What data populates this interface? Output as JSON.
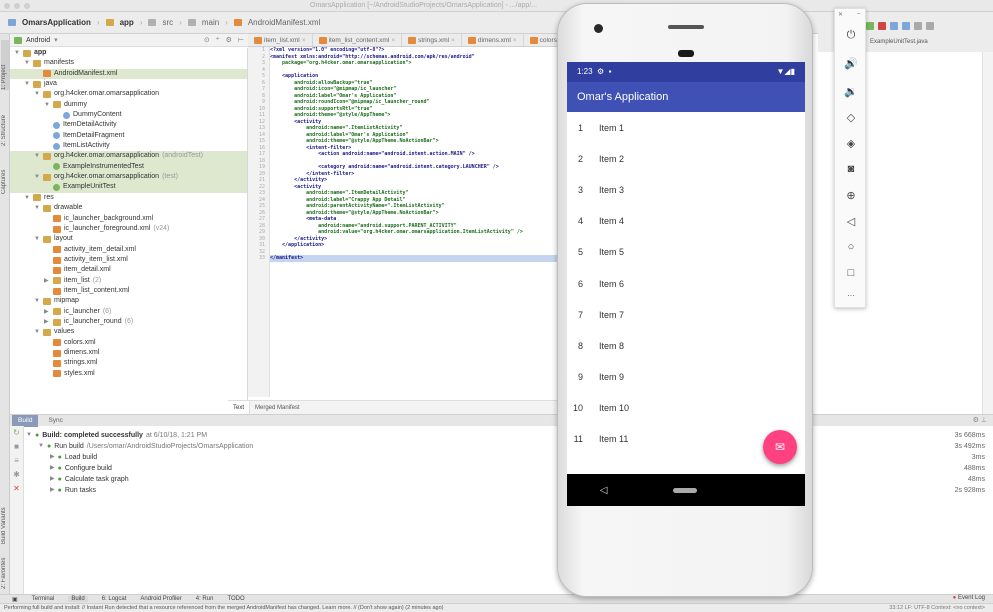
{
  "window": {
    "title": "OmarsApplication [~/AndroidStudioProjects/OmarsApplication] - .../app/..."
  },
  "navbar": {
    "crumbs": [
      "OmarsApplication",
      "app",
      "src",
      "main",
      "AndroidManifest.xml"
    ]
  },
  "project": {
    "view_label": "Android"
  },
  "side_tabs": [
    "1: Project",
    "2: Structure",
    "Captures",
    "Build Variants",
    "2: Favorites"
  ],
  "tree": [
    {
      "indent": 0,
      "arrow": "▼",
      "icon": "folder",
      "label": "app",
      "bold": true
    },
    {
      "indent": 1,
      "arrow": "▼",
      "icon": "folder",
      "label": "manifests"
    },
    {
      "indent": 2,
      "arrow": "",
      "icon": "manifest",
      "label": "AndroidManifest.xml",
      "highlight": true
    },
    {
      "indent": 1,
      "arrow": "▼",
      "icon": "folder",
      "label": "java"
    },
    {
      "indent": 2,
      "arrow": "▼",
      "icon": "folder",
      "label": "org.h4cker.omar.omarsapplication"
    },
    {
      "indent": 3,
      "arrow": "▼",
      "icon": "folder",
      "label": "dummy"
    },
    {
      "indent": 4,
      "arrow": "",
      "icon": "class",
      "label": "DummyContent"
    },
    {
      "indent": 3,
      "arrow": "",
      "icon": "class",
      "label": "ItemDetailActivity"
    },
    {
      "indent": 3,
      "arrow": "",
      "icon": "class",
      "label": "ItemDetailFragment"
    },
    {
      "indent": 3,
      "arrow": "",
      "icon": "class",
      "label": "ItemListActivity"
    },
    {
      "indent": 2,
      "arrow": "▼",
      "icon": "folder",
      "label": "org.h4cker.omar.omarsapplication",
      "suffix": "(androidTest)",
      "highlight": true
    },
    {
      "indent": 3,
      "arrow": "",
      "icon": "test",
      "label": "ExampleInstrumentedTest",
      "highlight": true
    },
    {
      "indent": 2,
      "arrow": "▼",
      "icon": "folder",
      "label": "org.h4cker.omar.omarsapplication",
      "suffix": "(test)",
      "highlight": true
    },
    {
      "indent": 3,
      "arrow": "",
      "icon": "test",
      "label": "ExampleUnitTest",
      "highlight": true
    },
    {
      "indent": 1,
      "arrow": "▼",
      "icon": "folder",
      "label": "res"
    },
    {
      "indent": 2,
      "arrow": "▼",
      "icon": "folder",
      "label": "drawable"
    },
    {
      "indent": 3,
      "arrow": "",
      "icon": "xml",
      "label": "ic_launcher_background.xml"
    },
    {
      "indent": 3,
      "arrow": "",
      "icon": "xml",
      "label": "ic_launcher_foreground.xml",
      "suffix": "(v24)"
    },
    {
      "indent": 2,
      "arrow": "▼",
      "icon": "folder",
      "label": "layout"
    },
    {
      "indent": 3,
      "arrow": "",
      "icon": "xml",
      "label": "activity_item_detail.xml"
    },
    {
      "indent": 3,
      "arrow": "",
      "icon": "xml",
      "label": "activity_item_list.xml"
    },
    {
      "indent": 3,
      "arrow": "",
      "icon": "xml",
      "label": "item_detail.xml"
    },
    {
      "indent": 3,
      "arrow": "▶",
      "icon": "folder",
      "label": "item_list",
      "suffix": "(2)"
    },
    {
      "indent": 3,
      "arrow": "",
      "icon": "xml",
      "label": "item_list_content.xml"
    },
    {
      "indent": 2,
      "arrow": "▼",
      "icon": "folder",
      "label": "mipmap"
    },
    {
      "indent": 3,
      "arrow": "▶",
      "icon": "folder",
      "label": "ic_launcher",
      "suffix": "(6)"
    },
    {
      "indent": 3,
      "arrow": "▶",
      "icon": "folder",
      "label": "ic_launcher_round",
      "suffix": "(6)"
    },
    {
      "indent": 2,
      "arrow": "▼",
      "icon": "folder",
      "label": "values"
    },
    {
      "indent": 3,
      "arrow": "",
      "icon": "xml",
      "label": "colors.xml"
    },
    {
      "indent": 3,
      "arrow": "",
      "icon": "xml",
      "label": "dimens.xml"
    },
    {
      "indent": 3,
      "arrow": "",
      "icon": "xml",
      "label": "strings.xml"
    },
    {
      "indent": 3,
      "arrow": "",
      "icon": "xml",
      "label": "styles.xml"
    }
  ],
  "editor_tabs": [
    "item_list.xml",
    "item_list_content.xml",
    "strings.xml",
    "dimens.xml",
    "colors.xml"
  ],
  "code_lines": [
    {
      "t": "<?xml version=\"1.0\" encoding=\"utf-8\"?>",
      "att": false
    },
    {
      "t": "<manifest xmlns:android=\"http://schemas.android.com/apk/res/android\"",
      "att": false
    },
    {
      "t": "    package=\"org.h4cker.omar.omarsapplication\">",
      "att": true
    },
    {
      "t": "",
      "att": false
    },
    {
      "t": "    <application",
      "att": false
    },
    {
      "t": "        android:allowBackup=\"true\"",
      "att": true
    },
    {
      "t": "        android:icon=\"@mipmap/ic_launcher\"",
      "att": true
    },
    {
      "t": "        android:label=\"Omar's Application\"",
      "att": true
    },
    {
      "t": "        android:roundIcon=\"@mipmap/ic_launcher_round\"",
      "att": true
    },
    {
      "t": "        android:supportsRtl=\"true\"",
      "att": true
    },
    {
      "t": "        android:theme=\"@style/AppTheme\">",
      "att": true
    },
    {
      "t": "        <activity",
      "att": false
    },
    {
      "t": "            android:name=\".ItemListActivity\"",
      "att": true
    },
    {
      "t": "            android:label=\"Omar's Application\"",
      "att": true
    },
    {
      "t": "            android:theme=\"@style/AppTheme.NoActionBar\">",
      "att": true
    },
    {
      "t": "            <intent-filter>",
      "att": false
    },
    {
      "t": "                <action android:name=\"android.intent.action.MAIN\" />",
      "att": false
    },
    {
      "t": "",
      "att": false
    },
    {
      "t": "                <category android:name=\"android.intent.category.LAUNCHER\" />",
      "att": false
    },
    {
      "t": "            </intent-filter>",
      "att": false
    },
    {
      "t": "        </activity>",
      "att": false
    },
    {
      "t": "        <activity",
      "att": false
    },
    {
      "t": "            android:name=\".ItemDetailActivity\"",
      "att": true
    },
    {
      "t": "            android:label=\"Crappy App Detail\"",
      "att": true
    },
    {
      "t": "            android:parentActivityName=\".ItemListActivity\"",
      "att": true
    },
    {
      "t": "            android:theme=\"@style/AppTheme.NoActionBar\">",
      "att": true
    },
    {
      "t": "            <meta-data",
      "att": false
    },
    {
      "t": "                android:name=\"android.support.PARENT_ACTIVITY\"",
      "att": true
    },
    {
      "t": "                android:value=\"org.h4cker.omar.omarsapplication.ItemListActivity\" />",
      "att": true
    },
    {
      "t": "        </activity>",
      "att": false
    },
    {
      "t": "    </application>",
      "att": false
    },
    {
      "t": "",
      "att": false
    },
    {
      "t": "</manifest>",
      "att": false,
      "sel": true
    }
  ],
  "editor_bottom_tabs": [
    "Text",
    "Merged Manifest"
  ],
  "right_tab": "ExampleUnitTest.java",
  "build": {
    "tabs": [
      "Build",
      "Sync"
    ],
    "rows": [
      {
        "indent": 0,
        "text": "Build: completed successfully",
        "dim": "at 6/10/18, 1:21 PM",
        "bold": true
      },
      {
        "indent": 1,
        "text": "Run build",
        "dim": "/Users/omar/AndroidStudioProjects/OmarsApplication"
      },
      {
        "indent": 2,
        "text": "Load build",
        "dim": ""
      },
      {
        "indent": 2,
        "text": "Configure build",
        "dim": ""
      },
      {
        "indent": 2,
        "text": "Calculate task graph",
        "dim": ""
      },
      {
        "indent": 2,
        "text": "Run tasks",
        "dim": ""
      }
    ],
    "times": [
      "3s 668ms",
      "3s 492ms",
      "3ms",
      "488ms",
      "48ms",
      "2s 928ms"
    ]
  },
  "bottom_tools": [
    "Terminal",
    "Build",
    "6: Logcat",
    "Android Profiler",
    "4: Run",
    "TODO"
  ],
  "event_log": "Event Log",
  "status": {
    "message": "Performing full build and install: // Instant Run detected that a resource referenced from the merged AndroidManifest has changed. Learn more. // (Don't show again) (2 minutes ago)",
    "right": "33:12  LF:  UTF-8  Context: <no context>"
  },
  "phone": {
    "time": "1:23",
    "app_title": "Omar's Application",
    "items": [
      {
        "n": "1",
        "label": "Item 1"
      },
      {
        "n": "2",
        "label": "Item 2"
      },
      {
        "n": "3",
        "label": "Item 3"
      },
      {
        "n": "4",
        "label": "Item 4"
      },
      {
        "n": "5",
        "label": "Item 5"
      },
      {
        "n": "6",
        "label": "Item 6"
      },
      {
        "n": "7",
        "label": "Item 7"
      },
      {
        "n": "8",
        "label": "Item 8"
      },
      {
        "n": "9",
        "label": "Item 9"
      },
      {
        "n": "10",
        "label": "Item 10"
      },
      {
        "n": "11",
        "label": "Item 11"
      }
    ],
    "colors": {
      "status": "#303F9F",
      "appbar": "#3F51B5",
      "fab": "#FF4081"
    }
  },
  "emulator_controls": [
    "power-icon",
    "volume-up-icon",
    "volume-down-icon",
    "rotate-left-icon",
    "rotate-right-icon",
    "camera-icon",
    "zoom-icon",
    "back-icon",
    "home-icon",
    "overview-icon",
    "more-icon"
  ]
}
